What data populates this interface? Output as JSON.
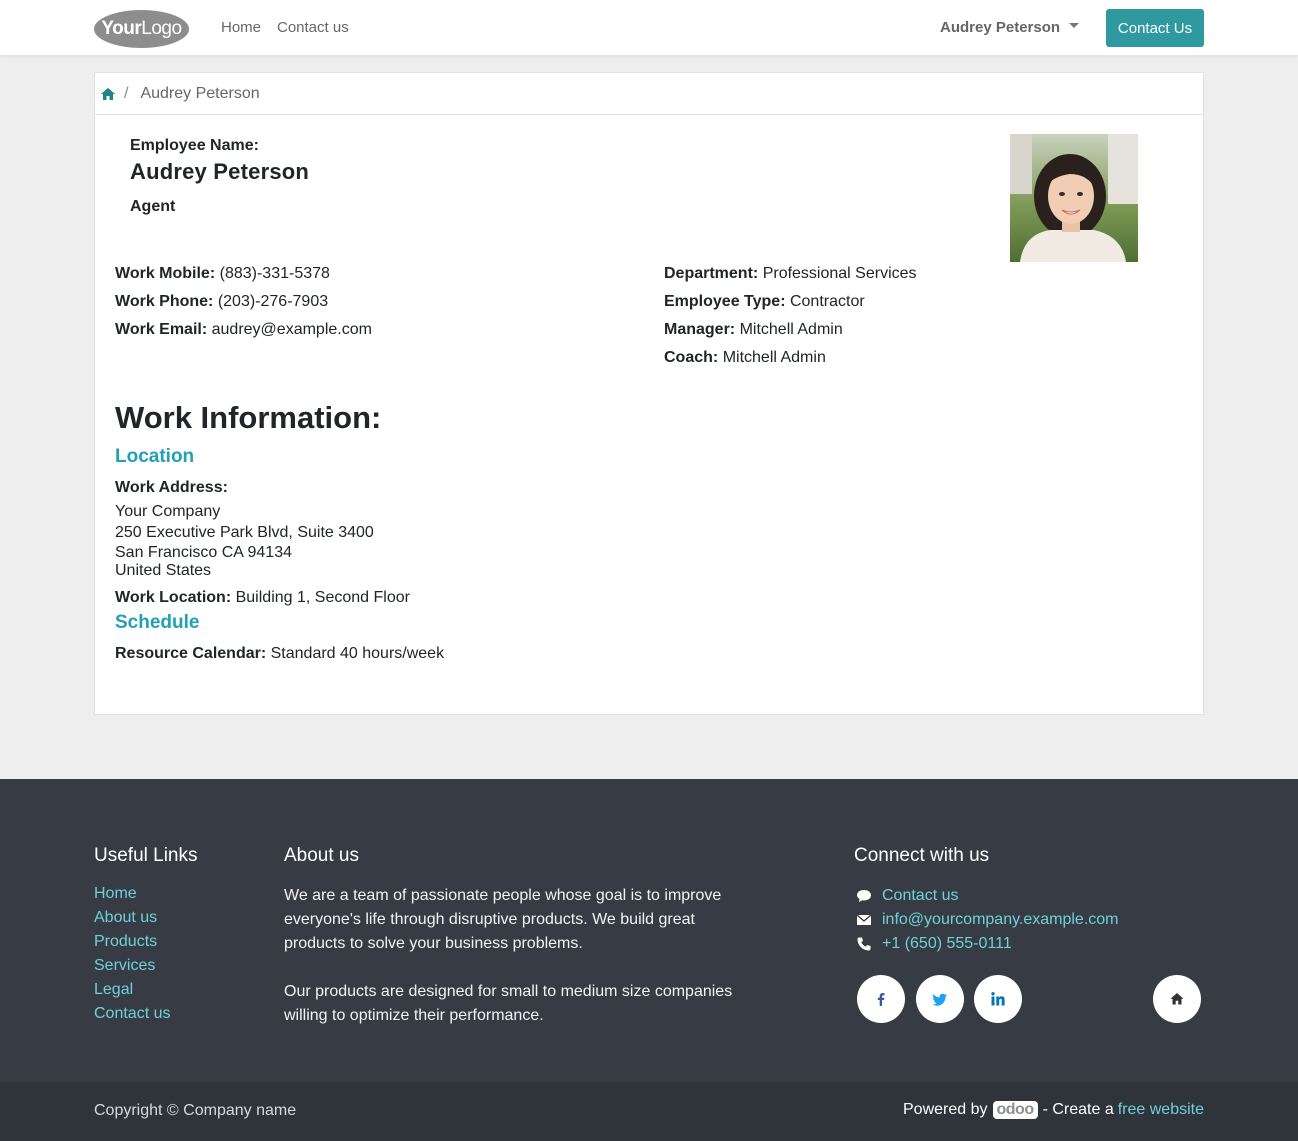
{
  "header": {
    "logo_bold": "Your",
    "logo_light": "Logo",
    "nav": [
      "Home",
      "Contact us"
    ],
    "user_name": "Audrey Peterson",
    "cta_label": "Contact Us"
  },
  "breadcrumb": {
    "separator": "/",
    "current": "Audrey Peterson"
  },
  "employee": {
    "name_label": "Employee Name:",
    "name": "Audrey Peterson",
    "job_title": "Agent",
    "left_fields": [
      {
        "label": "Work Mobile:",
        "value": "(883)-331-5378"
      },
      {
        "label": "Work Phone:",
        "value": "(203)-276-7903"
      },
      {
        "label": "Work Email:",
        "value": "audrey@example.com"
      }
    ],
    "right_fields": [
      {
        "label": "Department:",
        "value": "Professional Services"
      },
      {
        "label": "Employee Type:",
        "value": "Contractor"
      },
      {
        "label": "Manager:",
        "value": "Mitchell Admin"
      },
      {
        "label": "Coach:",
        "value": "Mitchell Admin"
      }
    ]
  },
  "work_info": {
    "title": "Work Information:",
    "location_heading": "Location",
    "address_label": "Work Address:",
    "address_lines": [
      "Your Company",
      "250 Executive Park Blvd, Suite 3400",
      "San Francisco CA 94134",
      "United States"
    ],
    "work_location_label": "Work Location:",
    "work_location": "Building 1, Second Floor",
    "schedule_heading": "Schedule",
    "calendar_label": "Resource Calendar:",
    "calendar": "Standard 40 hours/week"
  },
  "footer": {
    "links_heading": "Useful Links",
    "links": [
      "Home",
      "About us",
      "Products",
      "Services",
      "Legal",
      "Contact us"
    ],
    "about_heading": "About us",
    "about_p1": "We are a team of passionate people whose goal is to improve everyone's life through disruptive products. We build great products to solve your business problems.",
    "about_p2": "Our products are designed for small to medium size companies willing to optimize their performance.",
    "connect_heading": "Connect with us",
    "contact_link": "Contact us",
    "email": "info@yourcompany.example.com",
    "phone": "+1 (650) 555-0111",
    "social_icons": [
      "facebook-icon",
      "twitter-icon",
      "linkedin-icon",
      "home-icon"
    ]
  },
  "bottom": {
    "copyright": "Copyright © Company name",
    "powered_by": "Powered by",
    "odoo_logo": "odoo",
    "create_text": "- Create a",
    "free_website": "free website"
  },
  "colors": {
    "accent": "#2e9aa0",
    "link": "#6fd0d7",
    "subheading": "#23a0b5",
    "footer_bg": "#373c44"
  }
}
